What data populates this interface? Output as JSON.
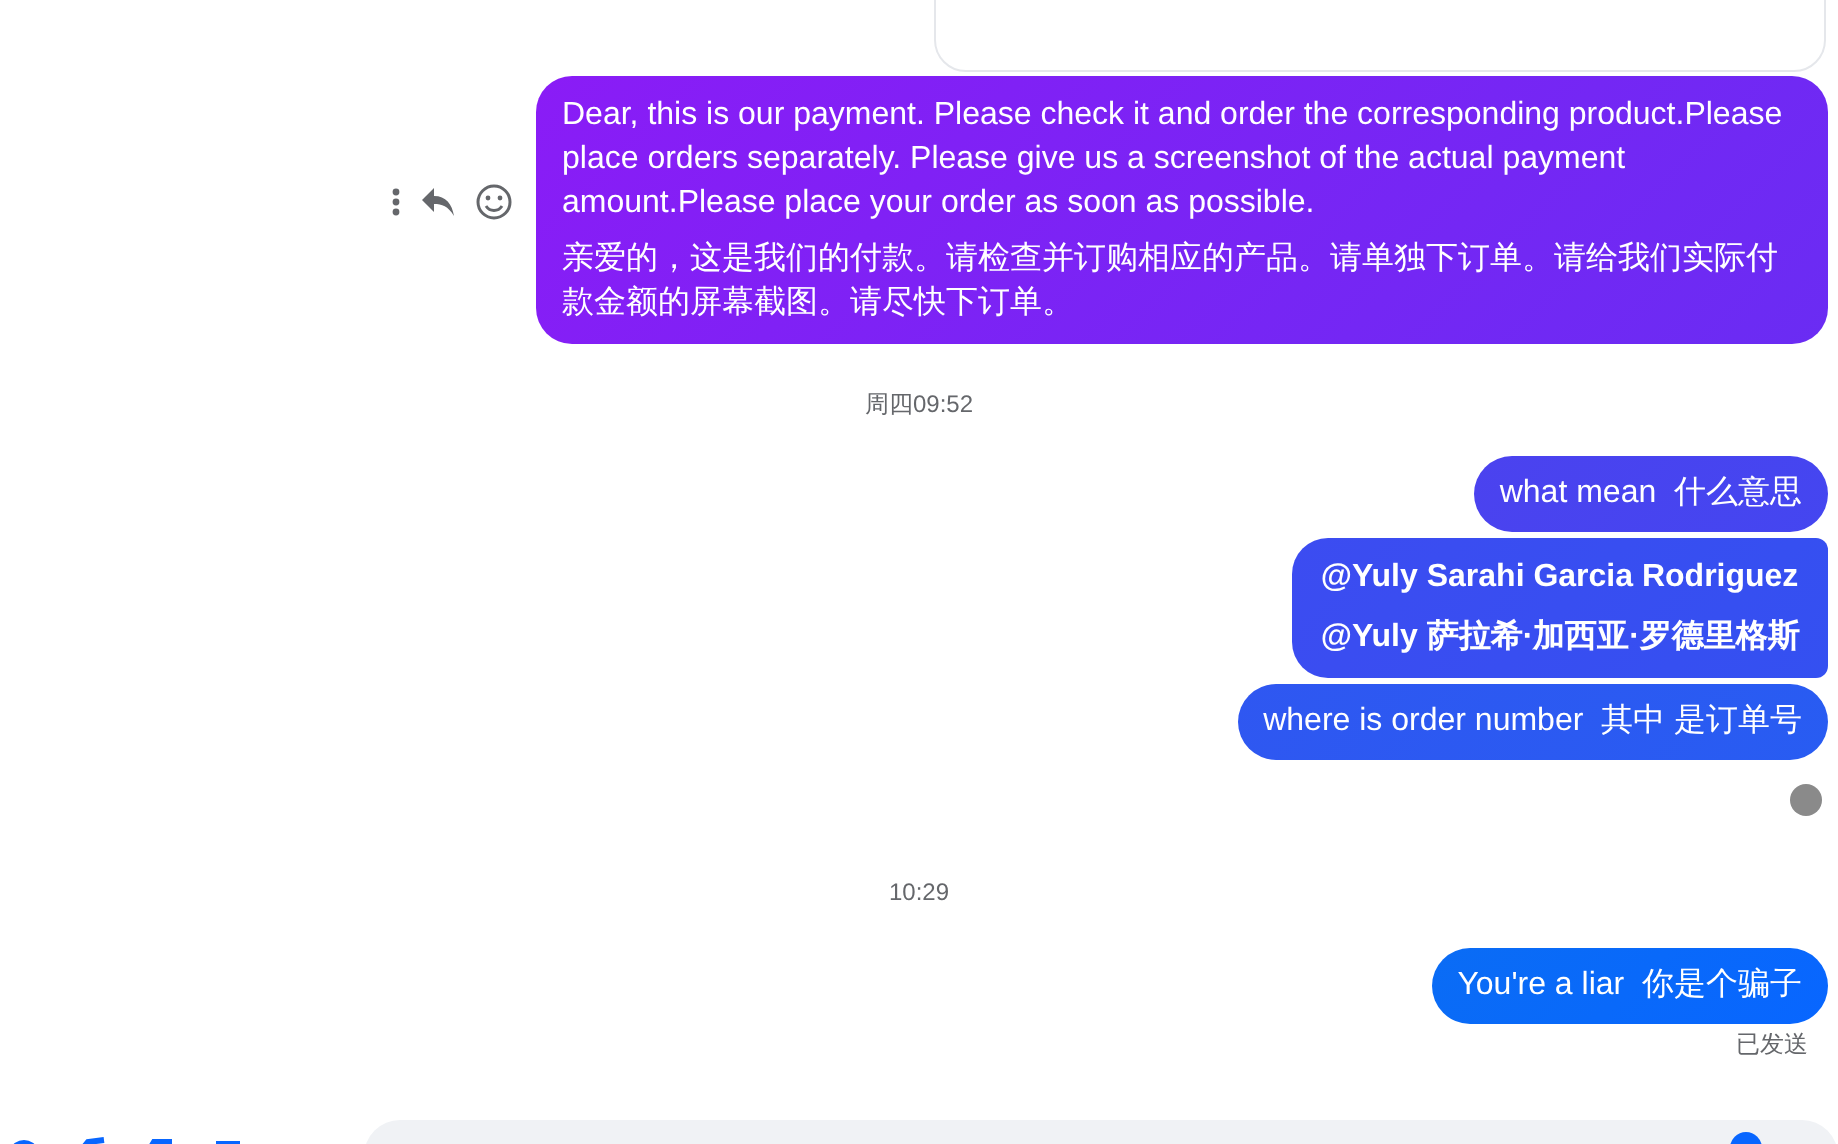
{
  "messages": [
    {
      "kind": "text",
      "paragraphs": [
        "Dear, this is our payment. Please check it and order the corresponding product.Please place orders separately. Please give us a screenshot of the actual payment amount.Please place your order as soon as possible.",
        "亲爱的，这是我们的付款。请检查并订购相应的产品。请单独下订单。请给我们实际付款金额的屏幕截图。请尽快下订单。"
      ],
      "actions": true
    },
    {
      "kind": "time",
      "text": "周四09:52"
    },
    {
      "kind": "text",
      "paragraphs": [
        "what mean  什么意思"
      ],
      "actions": false
    },
    {
      "kind": "mention",
      "paragraphs": [
        "@Yuly Sarahi Garcia Rodriguez",
        "@Yuly 萨拉希·加西亚·罗德里格斯"
      ],
      "actions": false
    },
    {
      "kind": "text",
      "paragraphs": [
        "where is order number  其中 是订单号"
      ],
      "actions": false
    },
    {
      "kind": "seen"
    },
    {
      "kind": "time",
      "text": "10:29"
    },
    {
      "kind": "text",
      "paragraphs": [
        "You're a liar  你是个骗子"
      ],
      "actions": false
    },
    {
      "kind": "status",
      "text": "已发送"
    }
  ]
}
